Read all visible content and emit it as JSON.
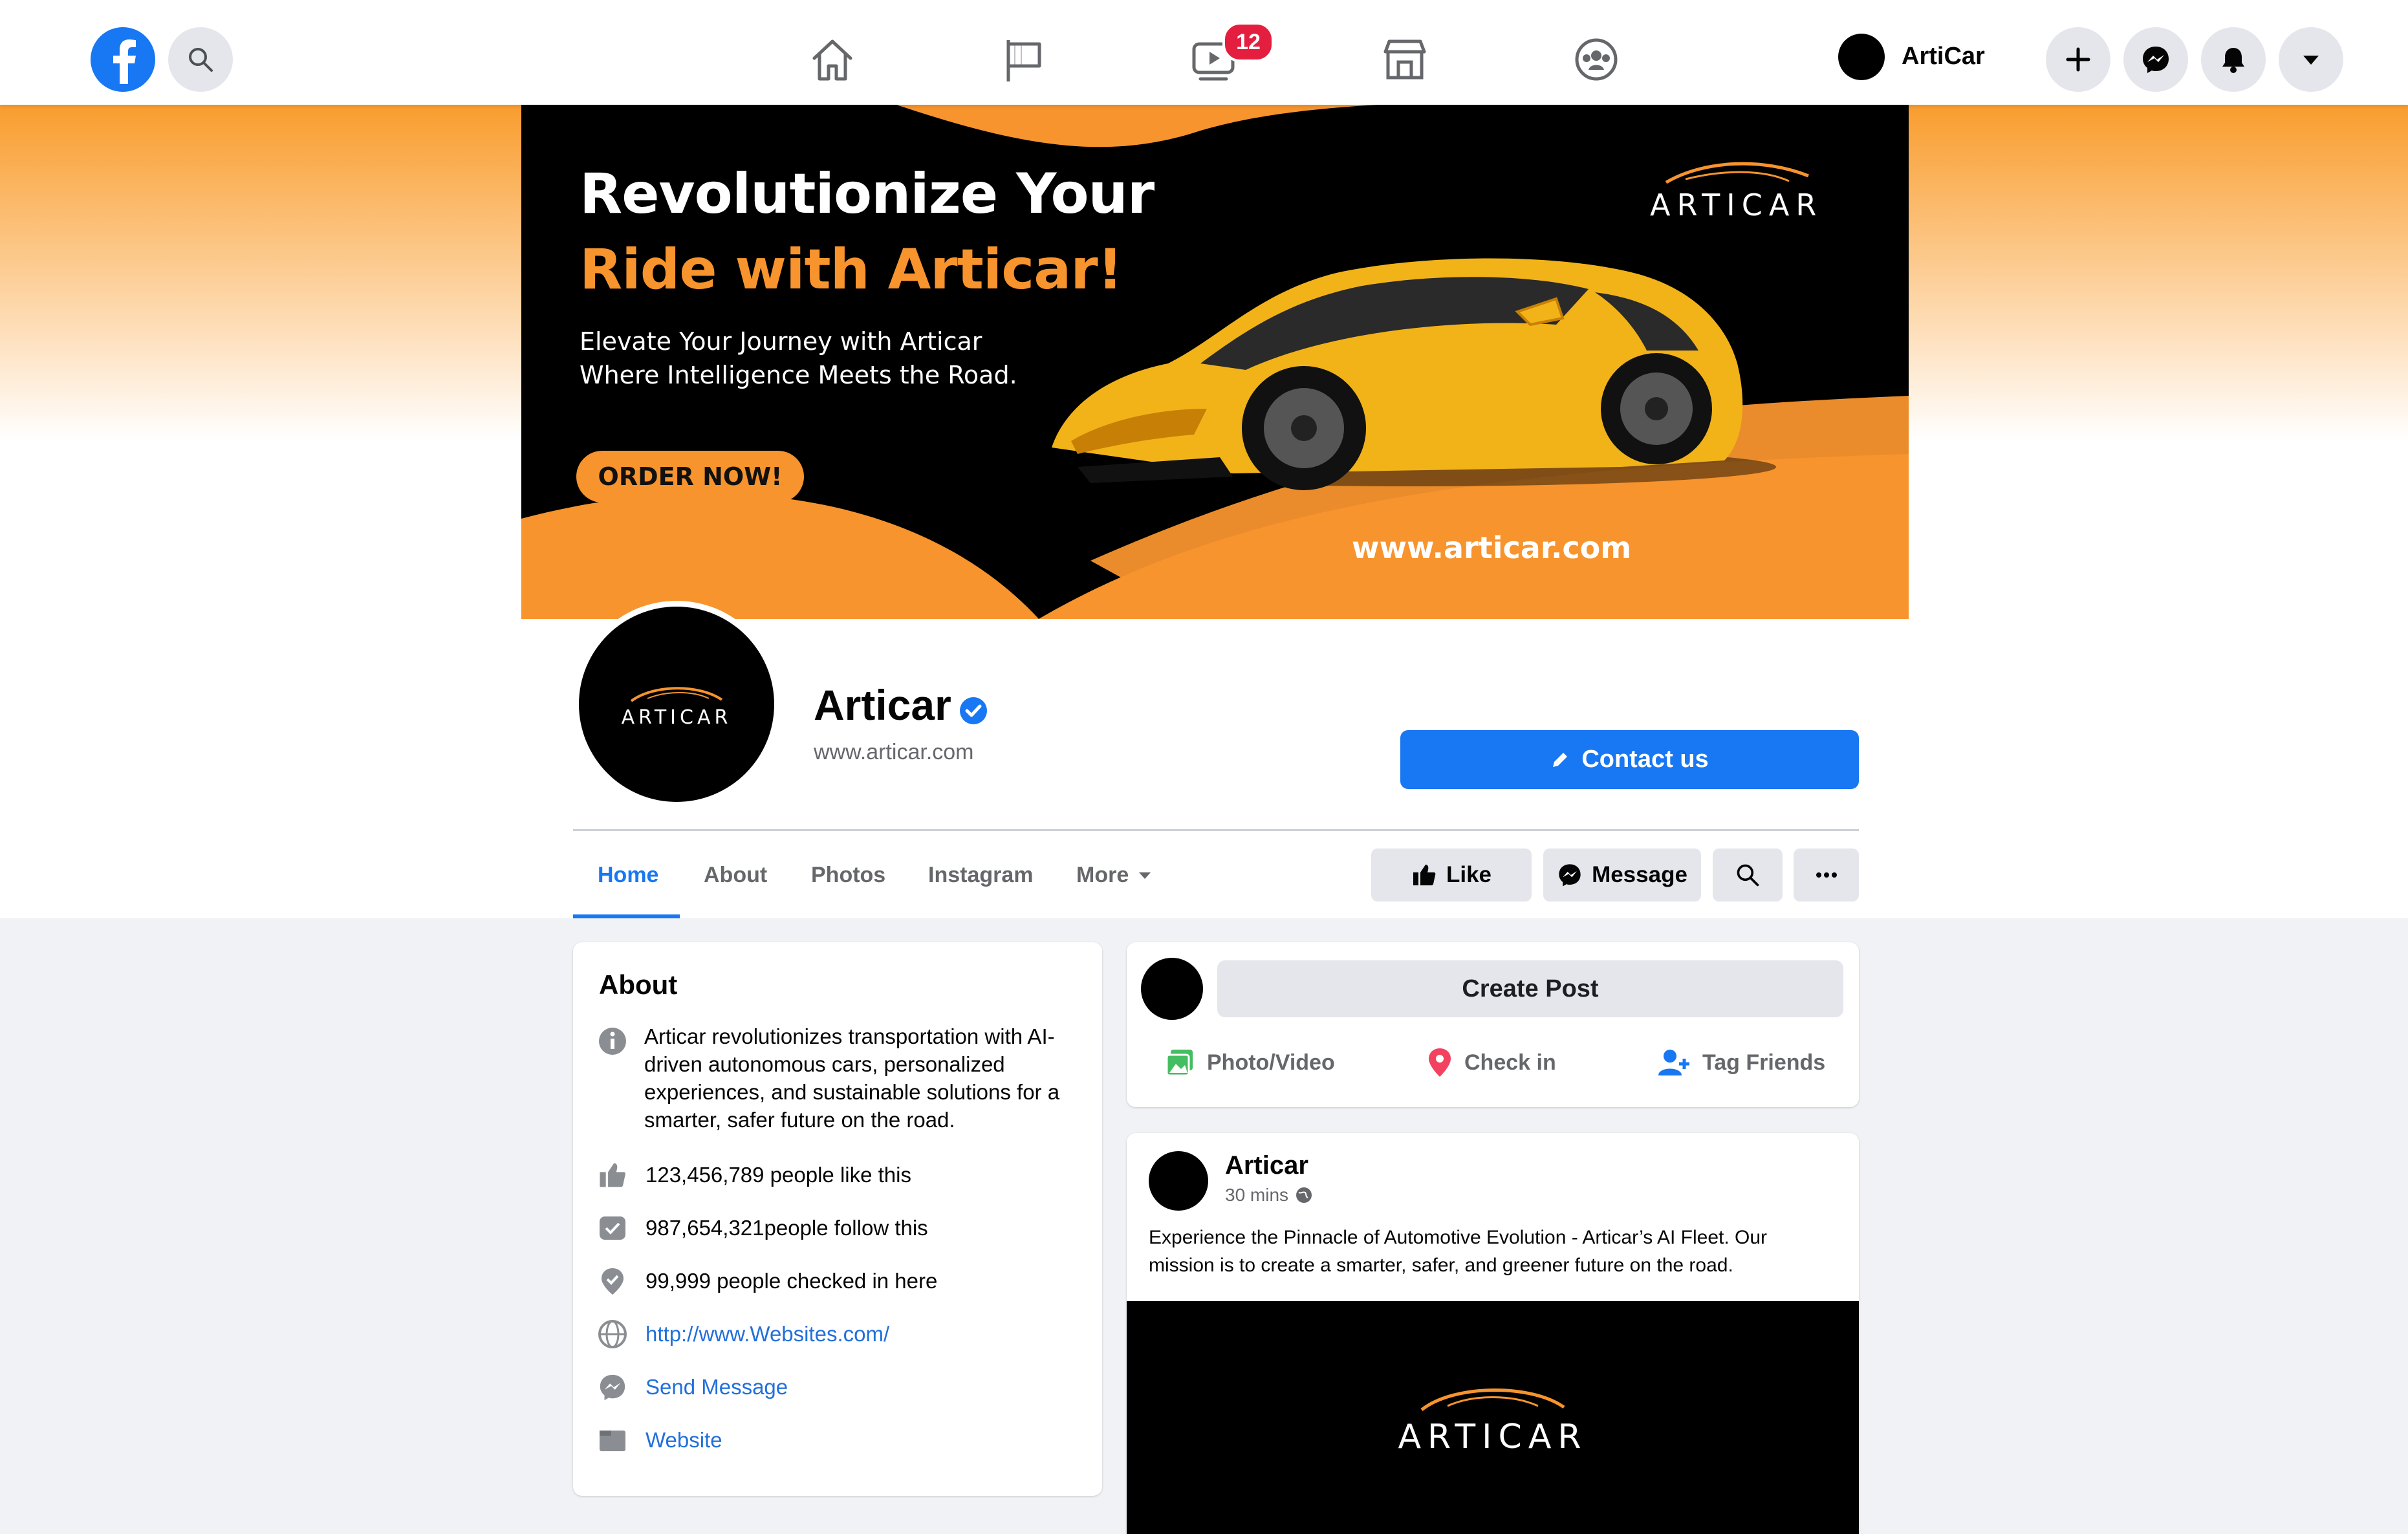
{
  "nav": {
    "badge_count": "12",
    "username": "ArtiCar",
    "icons": [
      "facebook-logo-icon",
      "search-icon",
      "home-icon",
      "flag-icon",
      "video-icon",
      "marketplace-icon",
      "groups-icon",
      "plus-icon",
      "messenger-icon",
      "bell-icon",
      "caret-down-icon"
    ]
  },
  "cover": {
    "headline_1": "Revolutionize Your",
    "headline_2": "Ride with Articar!",
    "subline_1": "Elevate Your Journey with Articar",
    "subline_2": "Where Intelligence Meets the Road.",
    "cta": "ORDER NOW!",
    "url": "www.articar.com",
    "brand": "ARTICAR",
    "colors": {
      "accent": "#f7942d",
      "dark": "#000000",
      "car": "#f2b318"
    }
  },
  "profile": {
    "name": "Articar",
    "website": "www.articar.com",
    "logo_text": "ARTICAR",
    "contact_label": "Contact us"
  },
  "tabs": [
    {
      "label": "Home"
    },
    {
      "label": "About"
    },
    {
      "label": "Photos"
    },
    {
      "label": "Instagram"
    },
    {
      "label": "More"
    }
  ],
  "actions": {
    "like": "Like",
    "message": "Message"
  },
  "about": {
    "title": "About",
    "description": "Articar revolutionizes transportation with AI-driven autonomous cars, personalized experiences, and sustainable solutions for a smarter, safer future on the road.",
    "likes": "123,456,789 people like this",
    "follows": "987,654,321people follow this",
    "checkins": "99,999 people checked in here",
    "link": "http://www.Websites.com/",
    "send_message": "Send Message",
    "website": "Website"
  },
  "create_post": {
    "label": "Create Post",
    "photo_video": "Photo/Video",
    "check_in": "Check in",
    "tag_friends": "Tag Friends"
  },
  "post": {
    "author": "Articar",
    "time": "30 mins",
    "text": "Experience the Pinnacle of Automotive Evolution - Articar’s AI Fleet. Our mission is to create a smarter, safer, and greener future on the road.",
    "media_logo": "ARTICAR"
  },
  "theme": {
    "primary": "#1877f2",
    "background": "#f0f2f5",
    "badge": "#e41e3f"
  }
}
